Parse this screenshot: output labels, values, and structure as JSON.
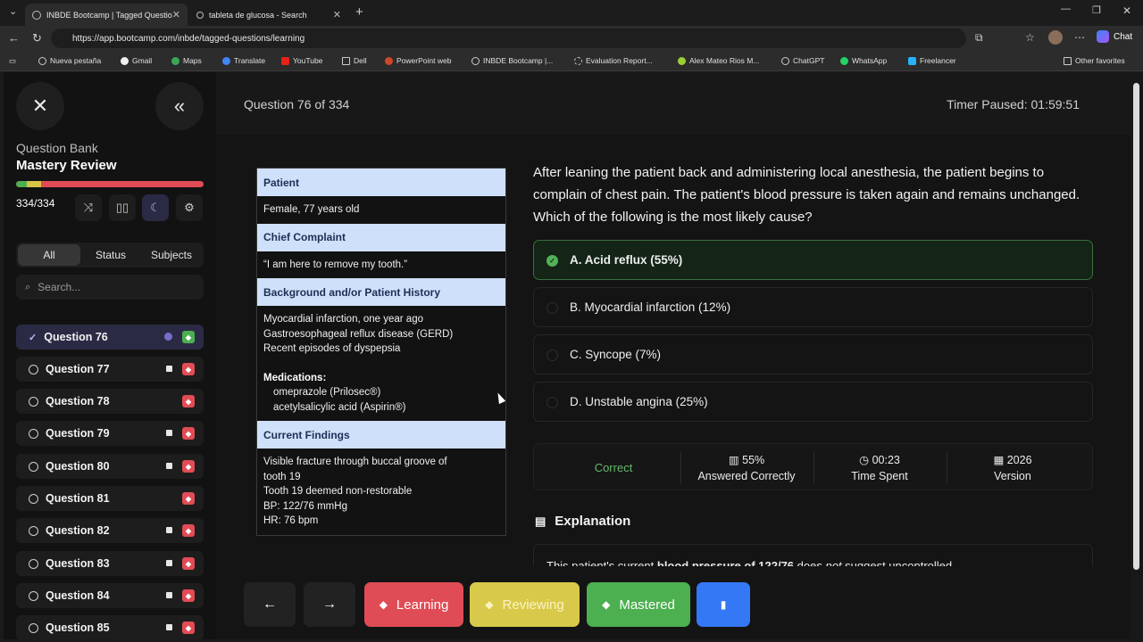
{
  "browser": {
    "tabs": [
      {
        "label": "INBDE Bootcamp | Tagged Questio"
      },
      {
        "label": "tableta de glucosa - Search"
      }
    ],
    "url": "https://app.bootcamp.com/inbde/tagged-questions/learning",
    "chat_label": "Chat",
    "bookmarks": [
      "Nueva pestaña",
      "Gmail",
      "Maps",
      "Translate",
      "YouTube",
      "Dell",
      "PowerPoint web",
      "INBDE Bootcamp |...",
      "Evaluation Report...",
      "Alex Mateo Rios M...",
      "ChatGPT",
      "WhatsApp",
      "Freelancer"
    ],
    "other_favorites": "Other favorites"
  },
  "sidebar": {
    "bank_label": "Question Bank",
    "mode_title": "Mastery Review",
    "count": "334/334",
    "filters": {
      "all": "All",
      "status": "Status",
      "subjects": "Subjects"
    },
    "search_placeholder": "Search...",
    "questions": [
      {
        "label": "Question 76",
        "state": "current",
        "tag": "green"
      },
      {
        "label": "Question 77",
        "state": "flagged",
        "tag": "red"
      },
      {
        "label": "Question 78",
        "state": "none",
        "tag": "red"
      },
      {
        "label": "Question 79",
        "state": "flagged",
        "tag": "red"
      },
      {
        "label": "Question 80",
        "state": "flagged",
        "tag": "red"
      },
      {
        "label": "Question 81",
        "state": "none",
        "tag": "red"
      },
      {
        "label": "Question 82",
        "state": "flagged",
        "tag": "red"
      },
      {
        "label": "Question 83",
        "state": "flagged",
        "tag": "red"
      },
      {
        "label": "Question 84",
        "state": "flagged",
        "tag": "red"
      },
      {
        "label": "Question 85",
        "state": "flagged",
        "tag": "red"
      }
    ]
  },
  "header": {
    "question_number": "Question 76 of 334",
    "timer": "Timer Paused: 01:59:51"
  },
  "patient": {
    "patient_h": "Patient",
    "patient_v": "Female, 77 years old",
    "complaint_h": "Chief Complaint",
    "complaint_v": "“I am here to remove my tooth.”",
    "history_h": "Background and/or Patient History",
    "history_lines": [
      "Myocardial infarction, one year ago",
      "Gastroesophageal reflux disease (GERD)",
      "Recent episodes of dyspepsia"
    ],
    "medications_label": "Medications:",
    "medications": [
      "omeprazole (Prilosec®)",
      "acetylsalicylic acid (Aspirin®)"
    ],
    "findings_h": "Current Findings",
    "findings_lines": [
      "Visible fracture through buccal groove of",
      "tooth 19",
      "Tooth 19 deemed non-restorable",
      "BP: 122/76 mmHg",
      "HR: 76 bpm"
    ]
  },
  "question": {
    "text": "After leaning the patient back and administering local anesthesia, the patient begins to complain of chest pain. The patient's blood pressure is taken again and remains unchanged. Which of the following is the most likely cause?",
    "options": [
      {
        "label": "A. Acid reflux  (55%)",
        "correct": true
      },
      {
        "label": "B. Myocardial infarction  (12%)",
        "correct": false
      },
      {
        "label": "C. Syncope  (7%)",
        "correct": false
      },
      {
        "label": "D. Unstable angina  (25%)",
        "correct": false
      }
    ]
  },
  "stats": {
    "result": "Correct",
    "pct": "55%",
    "pct_label": "Answered Correctly",
    "time": "00:23",
    "time_label": "Time Spent",
    "version": "2026",
    "version_label": "Version"
  },
  "explanation": {
    "heading": "Explanation",
    "start": "This patient's current ",
    "bold": "blood pressure of 122/76",
    "mid": " does ",
    "italic": "not",
    "end": " suggest uncontrolled"
  },
  "bottom": {
    "learning": "Learning",
    "reviewing": "Reviewing",
    "mastered": "Mastered"
  },
  "colors": {
    "learning": "#e04c55",
    "reviewing": "#d9c94a",
    "mastered": "#4caf50",
    "bookmark": "#3478f6",
    "accent": "#b9b6ff"
  }
}
